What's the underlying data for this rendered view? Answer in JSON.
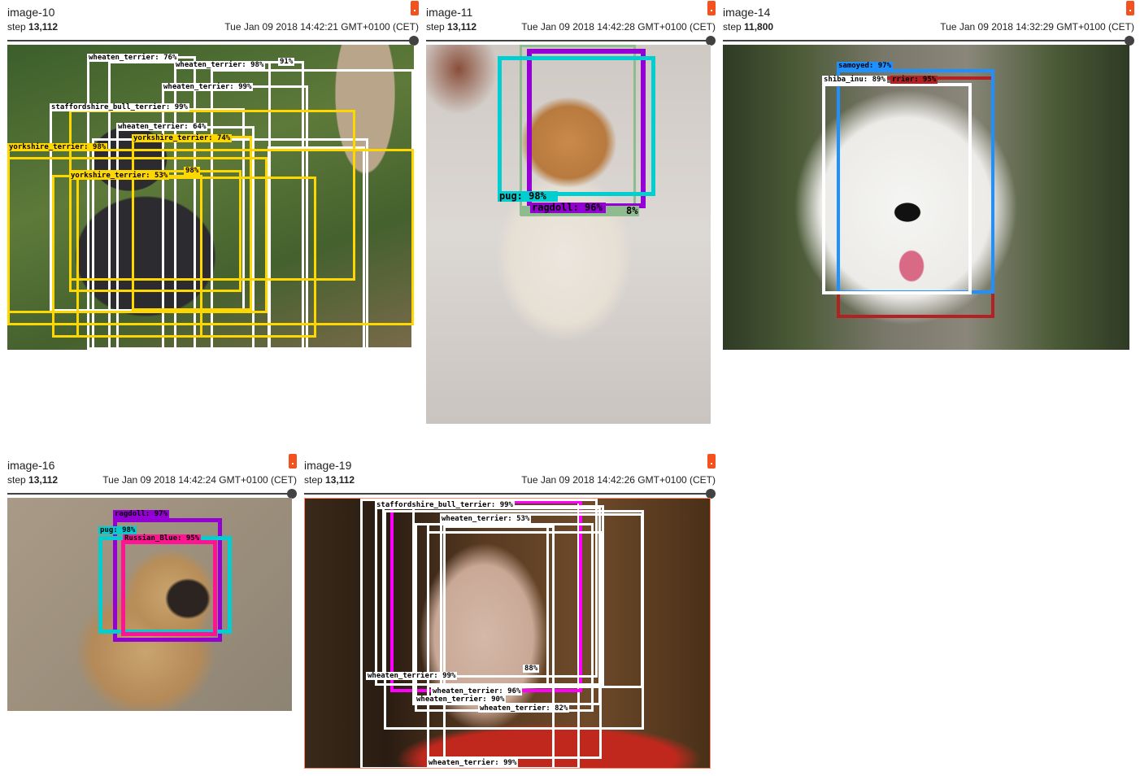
{
  "cards": [
    {
      "id": "image-10",
      "title": "image-10",
      "step_label": "step",
      "step_value": "13,112",
      "timestamp": "Tue Jan 09 2018 14:42:21 GMT+0100 (CET)",
      "photo_colors": [
        "#3b5e2b",
        "#5e7a3a",
        "#2b2b30",
        "#b8a58a"
      ],
      "detections": [
        {
          "label": "wheaten_terrier: 76%",
          "color": "#ffffff"
        },
        {
          "label": "wheaten_terrier: 98%",
          "color": "#ffffff"
        },
        {
          "label": "91%",
          "color": "#ffffff"
        },
        {
          "label": "wheaten_terrier: 99%",
          "color": "#ffffff"
        },
        {
          "label": "staffordshire_bull_terrier: 99%",
          "color": "#ffffff"
        },
        {
          "label": "wheaten_terrier: 64%",
          "color": "#ffffff"
        },
        {
          "label": "yorkshire_terrier: 74%",
          "color": "#ffd700"
        },
        {
          "label": "yorkshire_terrier: 98%",
          "color": "#ffd700"
        },
        {
          "label": "yorkshire_terrier: 53%",
          "color": "#ffd700"
        },
        {
          "label": "98%",
          "color": "#ffd700"
        }
      ]
    },
    {
      "id": "image-11",
      "title": "image-11",
      "step_label": "step",
      "step_value": "13,112",
      "timestamp": "Tue Jan 09 2018 14:42:28 GMT+0100 (CET)",
      "photo_colors": [
        "#d9d6d2",
        "#c98a4a",
        "#ece6de"
      ],
      "detections": [
        {
          "label": "pug: 98%",
          "color": "#00ced1"
        },
        {
          "label": "ragdoll: 96%",
          "color": "#9400d3"
        },
        {
          "label": "8%",
          "color": "#8fbc8f"
        }
      ]
    },
    {
      "id": "image-14",
      "title": "image-14",
      "step_label": "step",
      "step_value": "11,800",
      "timestamp": "Tue Jan 09 2018 14:32:29 GMT+0100 (CET)",
      "photo_colors": [
        "#6b6a5c",
        "#f2f2f0",
        "#2f3a24"
      ],
      "detections": [
        {
          "label": "samoyed: 97%",
          "color": "#1e90ff"
        },
        {
          "label": "shiba_inu: 89%",
          "color": "#ffffff"
        },
        {
          "label": "rrier: 95%",
          "color": "#b22222"
        }
      ]
    },
    {
      "id": "image-16",
      "title": "image-16",
      "step_label": "step",
      "step_value": "13,112",
      "timestamp": "Tue Jan 09 2018 14:42:24 GMT+0100 (CET)",
      "photo_colors": [
        "#a89a86",
        "#c9a46e",
        "#2b2420"
      ],
      "detections": [
        {
          "label": "ragdoll: 97%",
          "color": "#9400d3"
        },
        {
          "label": "pug: 98%",
          "color": "#00ced1"
        },
        {
          "label": "Russian_Blue: 95%",
          "color": "#ff1493"
        }
      ]
    },
    {
      "id": "image-19",
      "title": "image-19",
      "step_label": "step",
      "step_value": "13,112",
      "timestamp": "Tue Jan 09 2018 14:42:26 GMT+0100 (CET)",
      "photo_colors": [
        "#3a2a1a",
        "#d4b8a8",
        "#c0281e",
        "#6e4a2a"
      ],
      "detections": [
        {
          "label": "staffordshire_bull_terrier: 99%",
          "color": "#ffffff"
        },
        {
          "label": "wheaten_terrier: 53%",
          "color": "#ffffff"
        },
        {
          "label": "wheaten_terrier: 99%",
          "color": "#ffffff"
        },
        {
          "label": "88%",
          "color": "#ffffff"
        },
        {
          "label": "wheaten_terrier: 96%",
          "color": "#ffffff"
        },
        {
          "label": "wheaten_terrier: 90%",
          "color": "#ffffff"
        },
        {
          "label": "wheaten_terrier: 82%",
          "color": "#ffffff"
        },
        {
          "label": "wheaten_terrier: 99%",
          "color": "#ffffff"
        }
      ]
    }
  ],
  "icons": {
    "flag": "bug-flag-icon"
  }
}
